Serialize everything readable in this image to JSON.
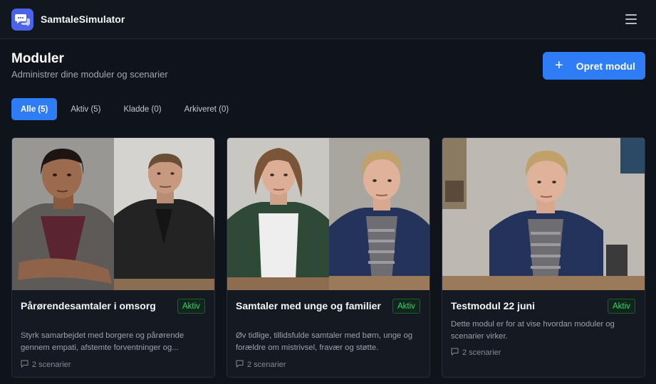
{
  "app": {
    "name": "SamtaleSimulator",
    "logo_icon": "chat-bubbles-icon",
    "menu_icon": "hamburger-menu-icon"
  },
  "header": {
    "title": "Moduler",
    "subtitle": "Administrer dine moduler og scenarier",
    "create_label": "Opret modul",
    "create_icon": "plus-icon"
  },
  "tabs": [
    {
      "label": "Alle (5)",
      "active": true
    },
    {
      "label": "Aktiv (5)",
      "active": false
    },
    {
      "label": "Kladde (0)",
      "active": false
    },
    {
      "label": "Arkiveret (0)",
      "active": false
    }
  ],
  "cards": [
    {
      "title": "Pårørendesamtaler i omsorg",
      "status": "Aktiv",
      "description": "Styrk samarbejdet med borgere og pårørende gennem empati, afstemte forventninger og...",
      "scenarios": "2 scenarier"
    },
    {
      "title": "Samtaler med unge og familier",
      "status": "Aktiv",
      "description": "Øv tidlige, tillidsfulde samtaler med børn, unge og forældre om mistrivsel, fravær og støtte.",
      "scenarios": "2 scenarier"
    },
    {
      "title": "Testmodul 22 juni",
      "status": "Aktiv",
      "description": "Dette modul er for at vise hvordan moduler og scenarier virker.",
      "scenarios": "2 scenarier"
    }
  ],
  "colors": {
    "accent": "#2f7df6",
    "status_active": "#3ecf74",
    "background": "#0f131a"
  }
}
